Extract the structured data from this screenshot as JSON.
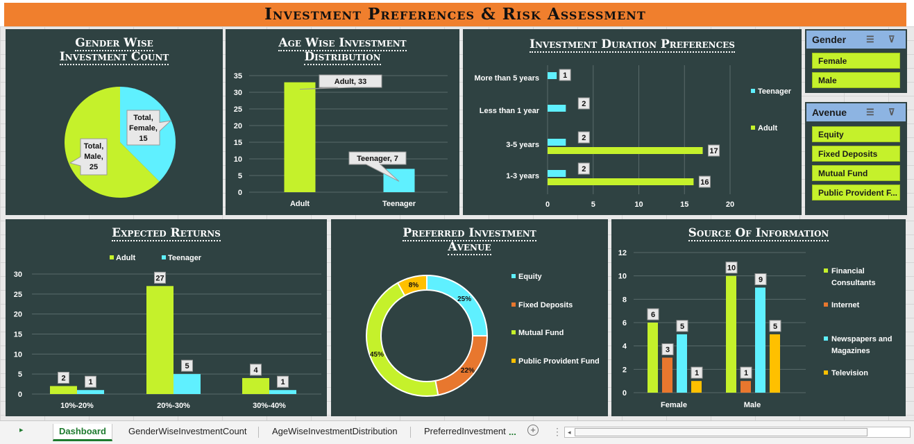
{
  "dashboard_title": "Investment Preferences & Risk Assessment",
  "colors": {
    "adult": "#c5f12b",
    "teenager": "#5ff0ff",
    "orange": "#e8772e",
    "yellow": "#ffc000",
    "panel": "#2f4242"
  },
  "gender_chart": {
    "title_line1": "Gender Wise",
    "title_line2": "Investment Count",
    "chart_data": {
      "type": "pie",
      "slices": [
        {
          "label": "Total, Female, 15",
          "category": "Female",
          "value": 15
        },
        {
          "label": "Total, Male, 25",
          "category": "Male",
          "value": 25
        }
      ]
    },
    "label_female": [
      "Total,",
      "Female,",
      "15"
    ],
    "label_male": [
      "Total,",
      "Male,",
      "25"
    ]
  },
  "age_chart": {
    "title_line1": "Age Wise Investment",
    "title_line2": "Distribution",
    "chart_data": {
      "type": "bar",
      "categories": [
        "Adult",
        "Teenager"
      ],
      "values": [
        33,
        7
      ],
      "ylim": [
        0,
        35
      ],
      "yticks": [
        0,
        5,
        10,
        15,
        20,
        25,
        30,
        35
      ],
      "data_labels": [
        "Adult, 33",
        "Teenager, 7"
      ]
    }
  },
  "duration_chart": {
    "title": "Investment Duration Preferences",
    "chart_data": {
      "type": "bar",
      "orientation": "horizontal",
      "categories": [
        "More than 5 years",
        "Less than 1 year",
        "3-5 years",
        "1-3 years"
      ],
      "series": [
        {
          "name": "Teenager",
          "values": [
            1,
            2,
            2,
            2
          ]
        },
        {
          "name": "Adult",
          "values": [
            0,
            0,
            17,
            16
          ]
        }
      ],
      "xlim": [
        0,
        20
      ],
      "xticks": [
        0,
        5,
        10,
        15,
        20
      ]
    }
  },
  "returns_chart": {
    "title": "Expected Returns",
    "chart_data": {
      "type": "bar",
      "categories": [
        "10%-20%",
        "20%-30%",
        "30%-40%"
      ],
      "series": [
        {
          "name": "Adult",
          "values": [
            2,
            27,
            4
          ]
        },
        {
          "name": "Teenager",
          "values": [
            1,
            5,
            1
          ]
        }
      ],
      "ylim": [
        0,
        30
      ],
      "yticks": [
        0,
        5,
        10,
        15,
        20,
        25,
        30
      ]
    }
  },
  "avenue_chart": {
    "title_line1": "Preferred Investment",
    "title_line2": "Avenue",
    "chart_data": {
      "type": "pie",
      "donut": true,
      "slices": [
        {
          "label": "Equity",
          "value": 25,
          "text": "25%",
          "color": "#5ff0ff"
        },
        {
          "label": "Fixed Deposits",
          "value": 22,
          "text": "22%",
          "color": "#e8772e"
        },
        {
          "label": "Mutual Fund",
          "value": 45,
          "text": "45%",
          "color": "#c5f12b"
        },
        {
          "label": "Public Provident Fund",
          "value": 8,
          "text": "8%",
          "color": "#ffc000"
        }
      ]
    }
  },
  "source_chart": {
    "title": "Source Of Information",
    "chart_data": {
      "type": "bar",
      "categories": [
        "Female",
        "Male"
      ],
      "series": [
        {
          "name": "Financial Consultants",
          "values": [
            6,
            10
          ],
          "color": "#c5f12b"
        },
        {
          "name": "Internet",
          "values": [
            3,
            1
          ],
          "color": "#e8772e"
        },
        {
          "name": "Newspapers and Magazines",
          "values": [
            5,
            9
          ],
          "color": "#5ff0ff"
        },
        {
          "name": "Television",
          "values": [
            1,
            5
          ],
          "color": "#ffc000"
        }
      ],
      "ylim": [
        0,
        12
      ],
      "yticks": [
        0,
        2,
        4,
        6,
        8,
        10,
        12
      ]
    },
    "legend_lines": [
      [
        "Financial",
        "Consultants"
      ],
      [
        "Internet"
      ],
      [
        "Newspapers and",
        "Magazines"
      ],
      [
        "Television"
      ]
    ]
  },
  "slicers": [
    {
      "title": "Gender",
      "items": [
        "Female",
        "Male"
      ]
    },
    {
      "title": "Avenue",
      "items": [
        "Equity",
        "Fixed Deposits",
        "Mutual Fund",
        "Public Provident F..."
      ]
    }
  ],
  "sheet_tabs": [
    {
      "label": "Dashboard",
      "active": true
    },
    {
      "label": "GenderWiseInvestmentCount",
      "active": false
    },
    {
      "label": "AgeWiseInvestmentDistribution",
      "active": false
    },
    {
      "label": "PreferredInvestment",
      "active": false
    }
  ],
  "tab_more": "...",
  "nav_icons": [
    "scroll-right-icon",
    "add-sheet-icon",
    "scroll-left-icon"
  ]
}
